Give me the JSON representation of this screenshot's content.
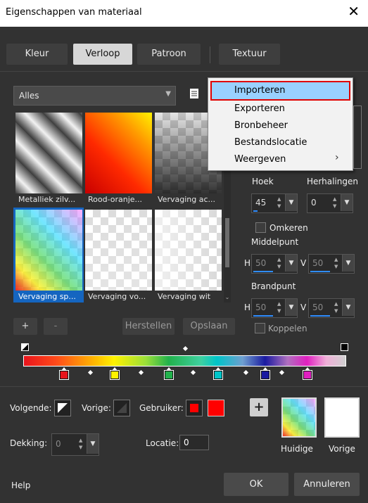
{
  "window": {
    "title": "Eigenschappen van materiaal",
    "close_glyph": "✕"
  },
  "tabs": [
    {
      "label": "Kleur",
      "active": false
    },
    {
      "label": "Verloop",
      "active": true
    },
    {
      "label": "Patroon",
      "active": false
    },
    {
      "label": "Textuur",
      "active": false
    }
  ],
  "category": {
    "value": "Alles"
  },
  "gradients": [
    "Metalliek zilv...",
    "Rood-oranje...",
    "Vervaging ac...",
    "Vervaging sp...",
    "Vervaging vo...",
    "Vervaging wit"
  ],
  "selected_gradient": 3,
  "context_menu": {
    "items": [
      "Importeren",
      "Exporteren",
      "Bronbeheer",
      "Bestandslocatie",
      "Weergeven"
    ],
    "highlighted": 0,
    "submenu_arrow": "›"
  },
  "properties": {
    "hoek_label": "Hoek",
    "hoek_value": "45",
    "herhalingen_label": "Herhalingen",
    "herhalingen_value": "0",
    "omkeren_label": "Omkeren",
    "middelpunt_label": "Middelpunt",
    "h_label": "H",
    "v_label": "V",
    "middelpunt_h": "50",
    "middelpunt_v": "50",
    "brandpunt_label": "Brandpunt",
    "brandpunt_h": "50",
    "brandpunt_v": "50",
    "koppelen_label": "Koppelen"
  },
  "buttons": {
    "add": "+",
    "remove": "-",
    "herstellen": "Herstellen",
    "opslaan": "Opslaan",
    "ok": "OK",
    "annuleren": "Annuleren",
    "help": "Help",
    "plus": "+"
  },
  "gradient_editor": {
    "stop_colors": [
      "#e8141c",
      "#fff200",
      "#22b14c",
      "#00c4c8",
      "#1a1aa0",
      "#e020c0"
    ]
  },
  "bottom": {
    "volgende_label": "Volgende:",
    "vorige_label": "Vorige:",
    "gebruiker_label": "Gebruiker:",
    "dekking_label": "Dekking:",
    "dekking_value": "0",
    "locatie_label": "Locatie:",
    "locatie_value": "0",
    "huidige_label": "Huidige",
    "vorige_preview_label": "Vorige",
    "user_color": "#ff0000"
  },
  "colors": {
    "accent": "#1565c0",
    "menu_highlight": "#99d1ff",
    "menu_border": "#e00000"
  }
}
